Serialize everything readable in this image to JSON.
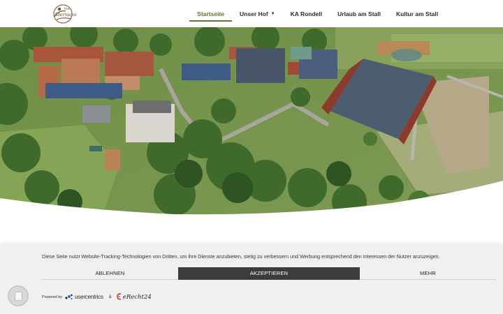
{
  "header": {
    "logo": {
      "icon": "farm-logo-icon",
      "small_text": "Hof",
      "script_text": "Allermann"
    },
    "nav": [
      {
        "label": "Startseite",
        "active": true,
        "dropdown": false
      },
      {
        "label": "Unser Hof",
        "active": false,
        "dropdown": true
      },
      {
        "label": "KA Rondell",
        "active": false,
        "dropdown": false
      },
      {
        "label": "Urlaub am Stall",
        "active": false,
        "dropdown": false
      },
      {
        "label": "Kultur am Stall",
        "active": false,
        "dropdown": false
      }
    ],
    "accent_color": "#5c7a2e"
  },
  "hero": {
    "image": "aerial-farm-photo"
  },
  "cookie_banner": {
    "text": "Diese Seite nutzt Website-Tracking-Technologien von Dritten, um ihre Dienste anzubieten, stetig zu verbessern und Werbung entsprechend den Interessen der Nutzer anzuzeigen.",
    "decline_label": "ABLEHNEN",
    "accept_label": "AKZEPTIEREN",
    "more_label": "MEHR",
    "powered_by": "Powered by",
    "usercentrics_label": "usercentrics",
    "ampersand": "&",
    "erecht_label": "eRecht24",
    "accept_color": "#3c3c3c"
  },
  "privacy_button": {
    "icon": "privacy-settings-icon"
  }
}
